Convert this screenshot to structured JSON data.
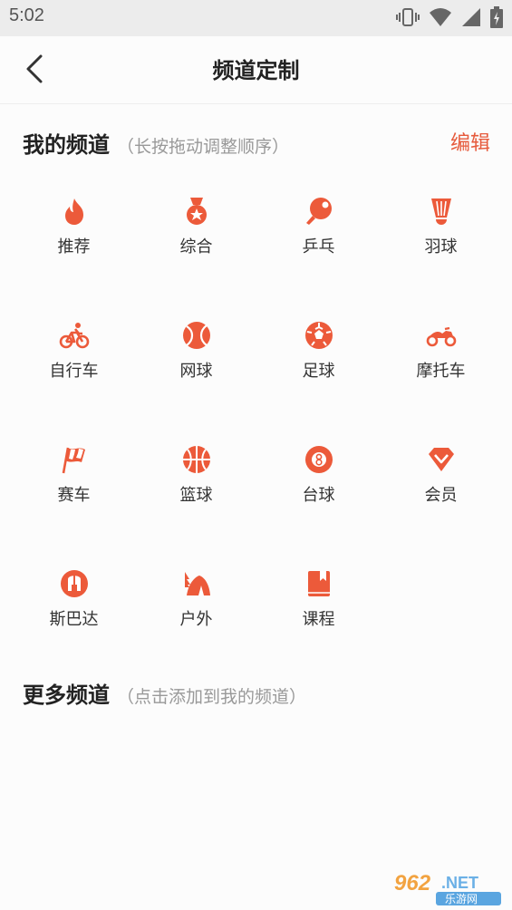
{
  "status_bar": {
    "time": "5:02"
  },
  "header": {
    "title": "频道定制"
  },
  "my_channels": {
    "title": "我的频道",
    "hint": "（长按拖动调整顺序）",
    "edit_label": "编辑",
    "items": [
      {
        "label": "推荐",
        "icon": "flame-icon"
      },
      {
        "label": "综合",
        "icon": "medal-icon"
      },
      {
        "label": "乒乓",
        "icon": "ping-pong-icon"
      },
      {
        "label": "羽球",
        "icon": "shuttlecock-icon"
      },
      {
        "label": "自行车",
        "icon": "bicycle-icon"
      },
      {
        "label": "网球",
        "icon": "tennis-ball-icon"
      },
      {
        "label": "足球",
        "icon": "soccer-ball-icon"
      },
      {
        "label": "摩托车",
        "icon": "motorcycle-icon"
      },
      {
        "label": "赛车",
        "icon": "checkered-flag-icon"
      },
      {
        "label": "篮球",
        "icon": "basketball-icon"
      },
      {
        "label": "台球",
        "icon": "billiard-ball-icon"
      },
      {
        "label": "会员",
        "icon": "diamond-icon"
      },
      {
        "label": "斯巴达",
        "icon": "spartan-helmet-icon"
      },
      {
        "label": "户外",
        "icon": "tent-icon"
      },
      {
        "label": "课程",
        "icon": "book-icon"
      }
    ]
  },
  "more_channels": {
    "title": "更多频道",
    "hint": "（点击添加到我的频道）"
  },
  "watermark": {
    "text_top": "962.NET",
    "text_bottom": "乐游网"
  },
  "colors": {
    "accent": "#e65a3c",
    "icon": "#ec5a3a"
  }
}
